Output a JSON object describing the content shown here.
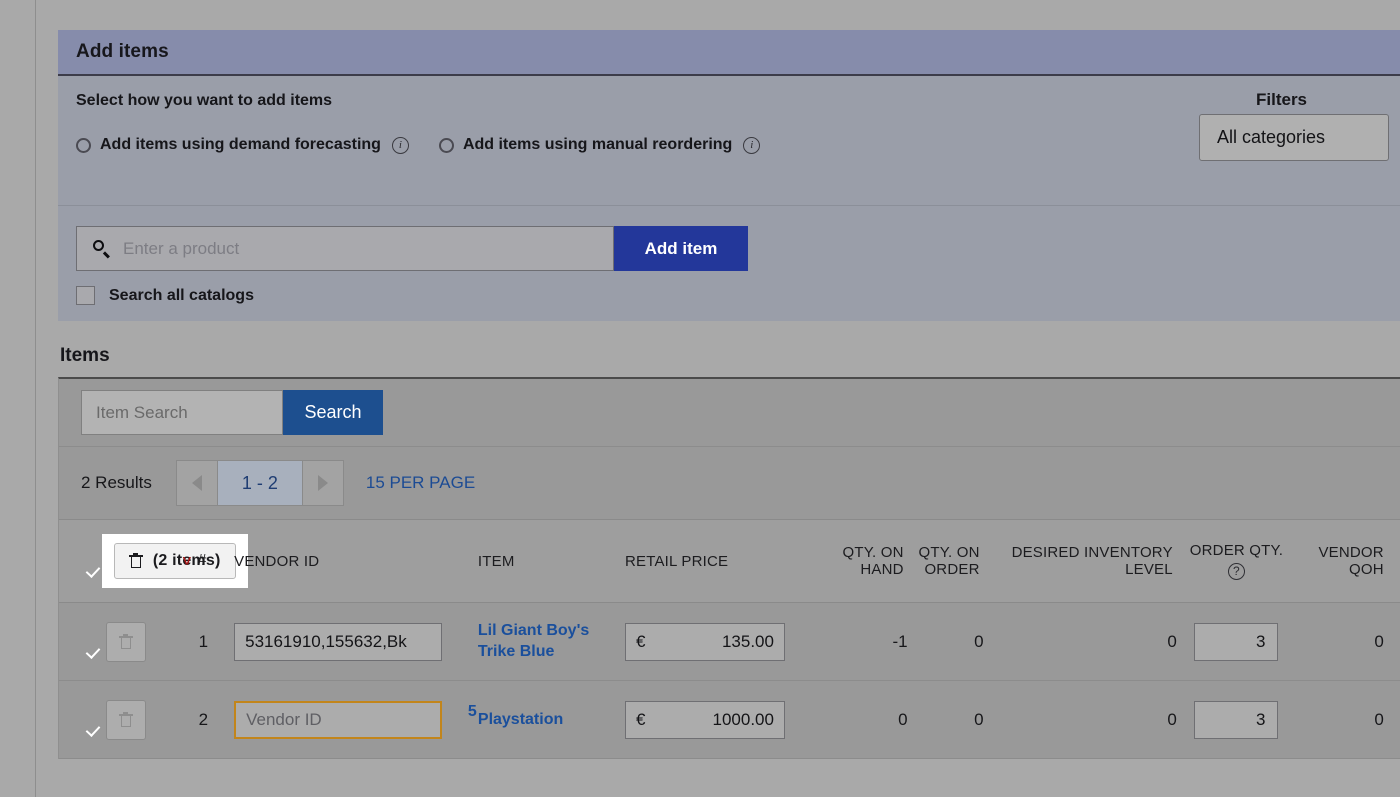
{
  "panel": {
    "title": "Add items",
    "select_how_label": "Select how you want to add items",
    "radios": [
      {
        "label": "Add items using demand forecasting",
        "info": "i",
        "selected": false
      },
      {
        "label": "Add items using manual reordering",
        "info": "i",
        "selected": false
      }
    ],
    "filters_label": "Filters",
    "filters_value": "All categories"
  },
  "search": {
    "product_placeholder": "Enter a product",
    "add_item_label": "Add item",
    "search_all_catalogs_label": "Search all catalogs",
    "search_all_catalogs_checked": false
  },
  "items": {
    "section_title": "Items",
    "item_search_placeholder": "Item Search",
    "search_button_label": "Search",
    "results_count": "2 Results",
    "page_range": "1 - 2",
    "per_page_label": "15 PER PAGE",
    "delete_pill_label": "(2 items)",
    "columns": {
      "num": "#",
      "vendor_id": "VENDOR ID",
      "item": "ITEM",
      "retail_price": "RETAIL PRICE",
      "qty_on_hand": "QTY. ON HAND",
      "qty_on_order": "QTY. ON ORDER",
      "desired_inventory_level": "DESIRED INVENTORY LEVEL",
      "order_qty": "ORDER QTY.",
      "order_qty_help": "?",
      "vendor_qoh": "VENDOR QOH"
    },
    "rows": [
      {
        "checked": true,
        "num": "1",
        "vendor_id_value": "53161910,155632,Bk",
        "vendor_id_placeholder": "",
        "vendor_id_highlight": false,
        "item_name": "Lil Giant Boy's Trike Blue",
        "currency": "€",
        "retail_price": "135.00",
        "qty_on_hand": "-1",
        "qty_on_order": "0",
        "desired_inventory_level": "0",
        "order_qty": "3",
        "vendor_qoh": "0",
        "tail_value": ""
      },
      {
        "checked": true,
        "num": "2",
        "vendor_id_value": "",
        "vendor_id_placeholder": "Vendor ID",
        "vendor_id_highlight": true,
        "item_name": "Playstation 5",
        "currency": "€",
        "retail_price": "1000.00",
        "qty_on_hand": "0",
        "qty_on_order": "0",
        "desired_inventory_level": "0",
        "order_qty": "3",
        "vendor_qoh": "0",
        "tail_value": ""
      }
    ]
  },
  "colors": {
    "panel_header": "#868cab",
    "panel_body": "#9a9ea9",
    "page_bg": "#a9a9a9",
    "table_bg": "#999999",
    "primary_button": "#23379a",
    "search_button": "#1d4f8f",
    "link": "#1a4f9c",
    "checkbox": "#1457cf",
    "highlight_border": "#c2851b",
    "sort_caret": "#a31515"
  }
}
